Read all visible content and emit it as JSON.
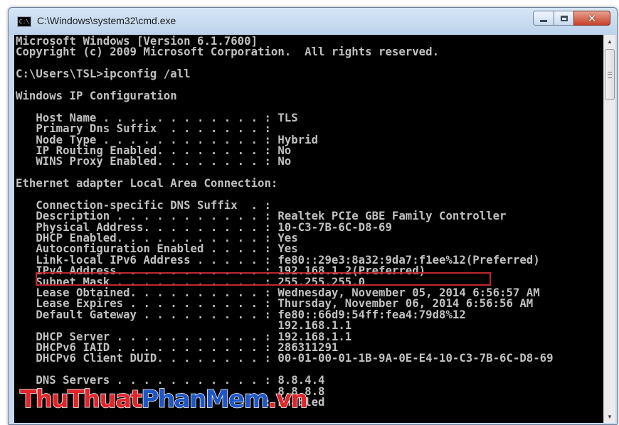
{
  "window": {
    "title": "C:\\Windows\\system32\\cmd.exe",
    "icon": "cmd-icon",
    "icon_label": "C:\\",
    "controls": [
      "minimize-icon",
      "maximize-icon",
      "close-icon"
    ],
    "close_glyph": "✕"
  },
  "console": {
    "lines": [
      "Microsoft Windows [Version 6.1.7600]",
      "Copyright (c) 2009 Microsoft Corporation.  All rights reserved.",
      "",
      "C:\\Users\\TSL>ipconfig /all",
      "",
      "Windows IP Configuration",
      "",
      "   Host Name . . . . . . . . . . . . : TLS",
      "   Primary Dns Suffix  . . . . . . . :",
      "   Node Type . . . . . . . . . . . . : Hybrid",
      "   IP Routing Enabled. . . . . . . . : No",
      "   WINS Proxy Enabled. . . . . . . . : No",
      "",
      "Ethernet adapter Local Area Connection:",
      "",
      "   Connection-specific DNS Suffix  . :",
      "   Description . . . . . . . . . . . : Realtek PCIe GBE Family Controller",
      "   Physical Address. . . . . . . . . : 10-C3-7B-6C-D8-69",
      "   DHCP Enabled. . . . . . . . . . . : Yes",
      "   Autoconfiguration Enabled . . . . : Yes",
      "   Link-local IPv6 Address . . . . . : fe80::29e3:8a32:9da7:f1ee%12(Preferred)",
      "   IPv4 Address. . . . . . . . . . . : 192.168.1.2(Preferred)",
      "   Subnet Mask . . . . . . . . . . . : 255.255.255.0",
      "   Lease Obtained. . . . . . . . . . : Wednesday, November 05, 2014 6:56:57 AM",
      "   Lease Expires . . . . . . . . . . : Thursday, November 06, 2014 6:56:56 AM",
      "   Default Gateway . . . . . . . . . : fe80::66d9:54ff:fea4:79d8%12",
      "                                       192.168.1.1",
      "   DHCP Server . . . . . . . . . . . : 192.168.1.1",
      "   DHCPv6 IAID . . . . . . . . . . . : 286311291",
      "   DHCPv6 Client DUID. . . . . . . . : 00-01-00-01-1B-9A-0E-E4-10-C3-7B-6C-D8-69",
      "",
      "   DNS Servers . . . . . . . . . . . : 8.8.4.4",
      "                                       8.8.8.8",
      "                                     : Enabled"
    ],
    "highlighted_line": "IPv4 Address. . . . . . . . . . . : 192.168.1.2(Preferred)",
    "colors": {
      "background": "#000000",
      "text": "#c0c0c0",
      "highlight": "#c0262c"
    }
  },
  "scrollbar": {
    "up_icon": "▲",
    "down_icon": "▼"
  },
  "watermark": {
    "part1": "ThuThuat",
    "part2": "PhanMem",
    "part3": ".vn"
  }
}
